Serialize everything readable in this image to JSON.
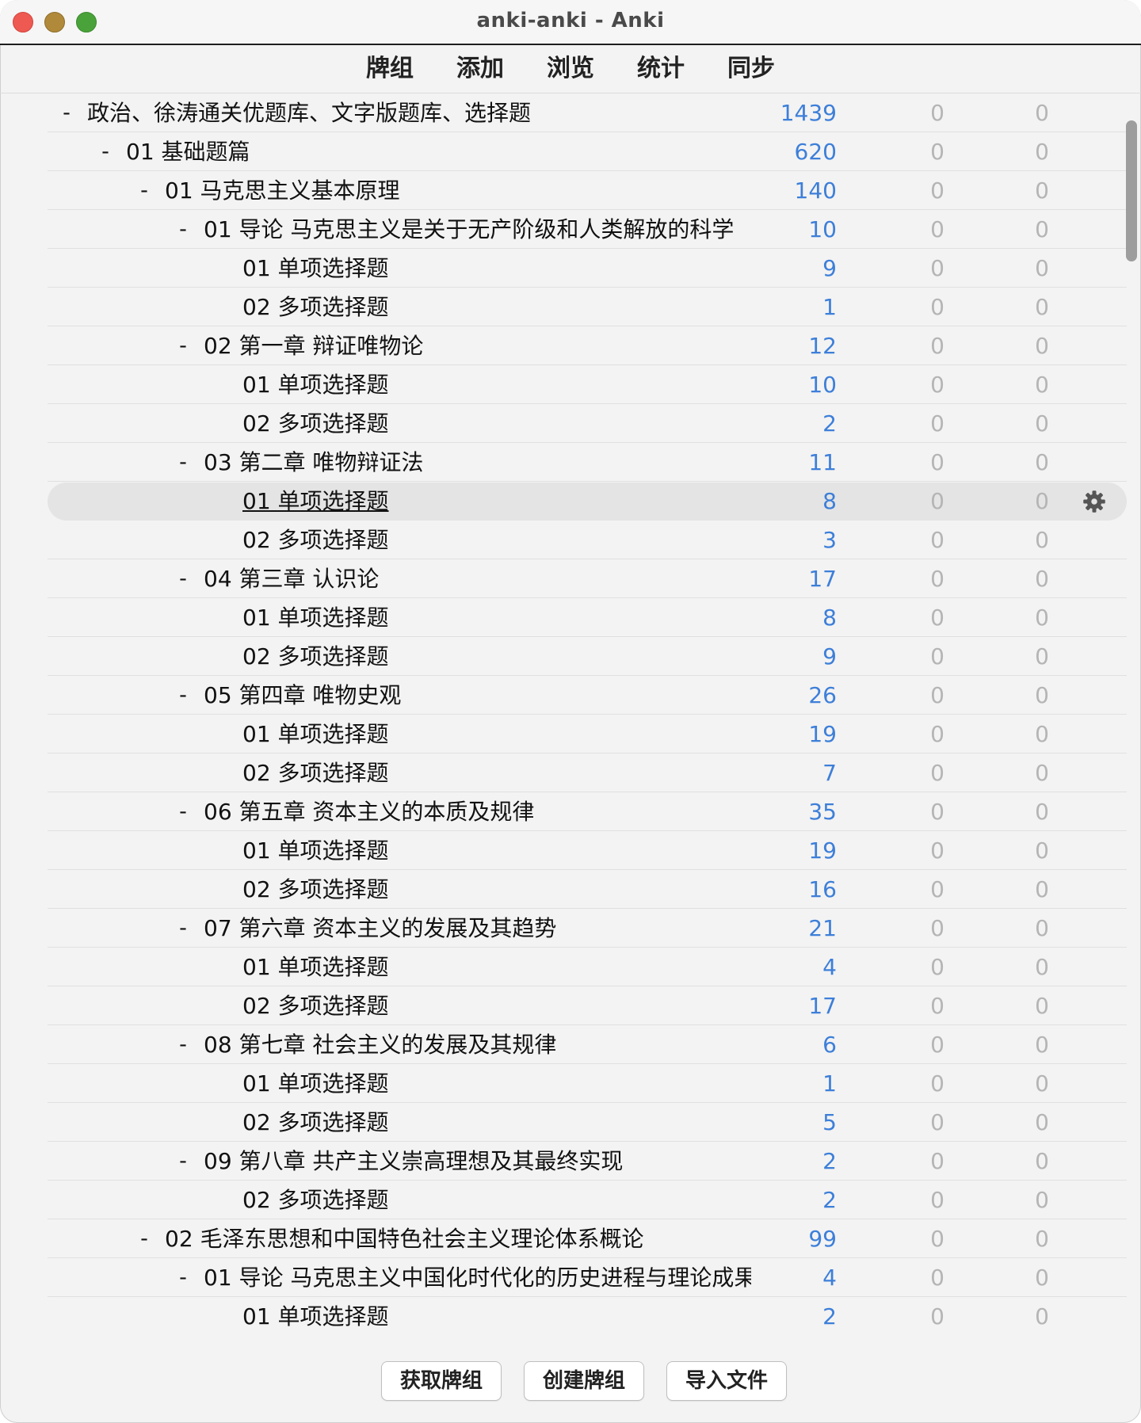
{
  "window": {
    "title": "anki-anki - Anki"
  },
  "toolbar": {
    "items": [
      "牌组",
      "添加",
      "浏览",
      "统计",
      "同步"
    ]
  },
  "decks": [
    {
      "collapse": "-",
      "name": "政治、徐涛通关优题库、文字版题库、选择题",
      "level": 0,
      "new": "1439",
      "learn": "0",
      "review": "0"
    },
    {
      "collapse": "-",
      "name": "01 基础题篇",
      "level": 1,
      "new": "620",
      "learn": "0",
      "review": "0"
    },
    {
      "collapse": "-",
      "name": "01 马克思主义基本原理",
      "level": 2,
      "new": "140",
      "learn": "0",
      "review": "0"
    },
    {
      "collapse": "-",
      "name": "01 导论 马克思主义是关于无产阶级和人类解放的科学",
      "level": 3,
      "new": "10",
      "learn": "0",
      "review": "0"
    },
    {
      "collapse": "",
      "name": "01 单项选择题",
      "level": 4,
      "new": "9",
      "learn": "0",
      "review": "0"
    },
    {
      "collapse": "",
      "name": "02 多项选择题",
      "level": 4,
      "new": "1",
      "learn": "0",
      "review": "0"
    },
    {
      "collapse": "-",
      "name": "02 第一章 辩证唯物论",
      "level": 3,
      "new": "12",
      "learn": "0",
      "review": "0"
    },
    {
      "collapse": "",
      "name": "01 单项选择题",
      "level": 4,
      "new": "10",
      "learn": "0",
      "review": "0"
    },
    {
      "collapse": "",
      "name": "02 多项选择题",
      "level": 4,
      "new": "2",
      "learn": "0",
      "review": "0"
    },
    {
      "collapse": "-",
      "name": "03 第二章 唯物辩证法",
      "level": 3,
      "new": "11",
      "learn": "0",
      "review": "0"
    },
    {
      "collapse": "",
      "name": "01 单项选择题",
      "level": 4,
      "new": "8",
      "learn": "0",
      "review": "0",
      "selected": true
    },
    {
      "collapse": "",
      "name": "02 多项选择题",
      "level": 4,
      "new": "3",
      "learn": "0",
      "review": "0"
    },
    {
      "collapse": "-",
      "name": "04 第三章 认识论",
      "level": 3,
      "new": "17",
      "learn": "0",
      "review": "0"
    },
    {
      "collapse": "",
      "name": "01 单项选择题",
      "level": 4,
      "new": "8",
      "learn": "0",
      "review": "0"
    },
    {
      "collapse": "",
      "name": "02 多项选择题",
      "level": 4,
      "new": "9",
      "learn": "0",
      "review": "0"
    },
    {
      "collapse": "-",
      "name": "05 第四章 唯物史观",
      "level": 3,
      "new": "26",
      "learn": "0",
      "review": "0"
    },
    {
      "collapse": "",
      "name": "01 单项选择题",
      "level": 4,
      "new": "19",
      "learn": "0",
      "review": "0"
    },
    {
      "collapse": "",
      "name": "02 多项选择题",
      "level": 4,
      "new": "7",
      "learn": "0",
      "review": "0"
    },
    {
      "collapse": "-",
      "name": "06 第五章 资本主义的本质及规律",
      "level": 3,
      "new": "35",
      "learn": "0",
      "review": "0"
    },
    {
      "collapse": "",
      "name": "01 单项选择题",
      "level": 4,
      "new": "19",
      "learn": "0",
      "review": "0"
    },
    {
      "collapse": "",
      "name": "02 多项选择题",
      "level": 4,
      "new": "16",
      "learn": "0",
      "review": "0"
    },
    {
      "collapse": "-",
      "name": "07 第六章 资本主义的发展及其趋势",
      "level": 3,
      "new": "21",
      "learn": "0",
      "review": "0"
    },
    {
      "collapse": "",
      "name": "01 单项选择题",
      "level": 4,
      "new": "4",
      "learn": "0",
      "review": "0"
    },
    {
      "collapse": "",
      "name": "02 多项选择题",
      "level": 4,
      "new": "17",
      "learn": "0",
      "review": "0"
    },
    {
      "collapse": "-",
      "name": "08 第七章 社会主义的发展及其规律",
      "level": 3,
      "new": "6",
      "learn": "0",
      "review": "0"
    },
    {
      "collapse": "",
      "name": "01 单项选择题",
      "level": 4,
      "new": "1",
      "learn": "0",
      "review": "0"
    },
    {
      "collapse": "",
      "name": "02 多项选择题",
      "level": 4,
      "new": "5",
      "learn": "0",
      "review": "0"
    },
    {
      "collapse": "-",
      "name": "09 第八章 共产主义崇高理想及其最终实现",
      "level": 3,
      "new": "2",
      "learn": "0",
      "review": "0"
    },
    {
      "collapse": "",
      "name": "02 多项选择题",
      "level": 4,
      "new": "2",
      "learn": "0",
      "review": "0"
    },
    {
      "collapse": "-",
      "name": "02 毛泽东思想和中国特色社会主义理论体系概论",
      "level": 2,
      "new": "99",
      "learn": "0",
      "review": "0"
    },
    {
      "collapse": "-",
      "name": "01 导论 马克思主义中国化时代化的历史进程与理论成果",
      "level": 3,
      "new": "4",
      "learn": "0",
      "review": "0"
    },
    {
      "collapse": "",
      "name": "01 单项选择题",
      "level": 4,
      "new": "2",
      "learn": "0",
      "review": "0"
    }
  ],
  "footer": {
    "get_shared": "获取牌组",
    "create_deck": "创建牌组",
    "import_file": "导入文件"
  },
  "colors": {
    "new_count": "#3d7fd9",
    "zero_count": "#b5b5b5",
    "selected_row": "#e4e4e4"
  },
  "icons": {
    "deck_options": "gear-icon"
  }
}
